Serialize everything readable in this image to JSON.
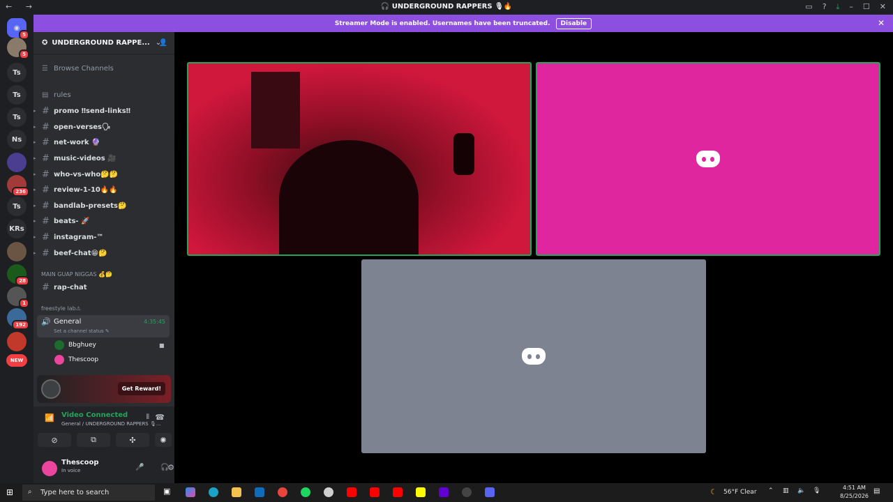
{
  "window": {
    "title": "🎧 UNDERGROUND RAPPERS 🎙🔥",
    "nav": "← →"
  },
  "banner": {
    "text": "Streamer Mode is enabled. Usernames have been truncated.",
    "disable_label": "Disable",
    "color": "#8c4fe0"
  },
  "rail": {
    "servers": [
      {
        "label": "Ts"
      },
      {
        "label": "Ts"
      },
      {
        "label": "Ts"
      },
      {
        "label": "Ns"
      },
      {
        "label": "Ts"
      },
      {
        "label": "KRs"
      }
    ],
    "badges": [
      "5",
      "5",
      "236",
      "28",
      "1",
      "192"
    ],
    "new_label": "NEW"
  },
  "server": {
    "name": "UNDERGROUND RAPPE...",
    "browse_channels": "Browse Channels",
    "channels": [
      {
        "name": "rules"
      },
      {
        "name": "promo ‼send-links‼"
      },
      {
        "name": "open-verses🗣"
      },
      {
        "name": "net-work 🔮"
      },
      {
        "name": "music-videos 🎥"
      },
      {
        "name": "who-vs-who🤔🤔"
      },
      {
        "name": "review-1-10🔥🔥"
      },
      {
        "name": "bandlab-presets🤔"
      },
      {
        "name": "beats- 🚀"
      },
      {
        "name": "instagram-™"
      },
      {
        "name": "beef-chat😁🤔"
      }
    ],
    "category_main": "MAIN GUAP NIGGAS 💰🤔",
    "rap_chat": "rap-chat",
    "category_freestyle": "freestyle lab⚠",
    "voice_channel": {
      "name": "General",
      "timer": "4:35:45",
      "status_hint": "Set a channel status ✎",
      "users": [
        "Bbghuey",
        "Thescoop"
      ]
    }
  },
  "promo": {
    "button": "Get Reward!"
  },
  "voice_panel": {
    "status": "Video Connected",
    "sub": "General / UNDERGROUND RAPPERS 🎙..."
  },
  "user": {
    "name": "Thescoop",
    "status": "In voice"
  },
  "video": {
    "tile_live_color": "#d0173c",
    "tile_pink_color": "#e0269e",
    "tile_gray_color": "#7d8390"
  },
  "taskbar": {
    "search_placeholder": "Type here to search",
    "weather": "56°F  Clear",
    "time": "4:51 AM",
    "date": "8/25/2026"
  }
}
